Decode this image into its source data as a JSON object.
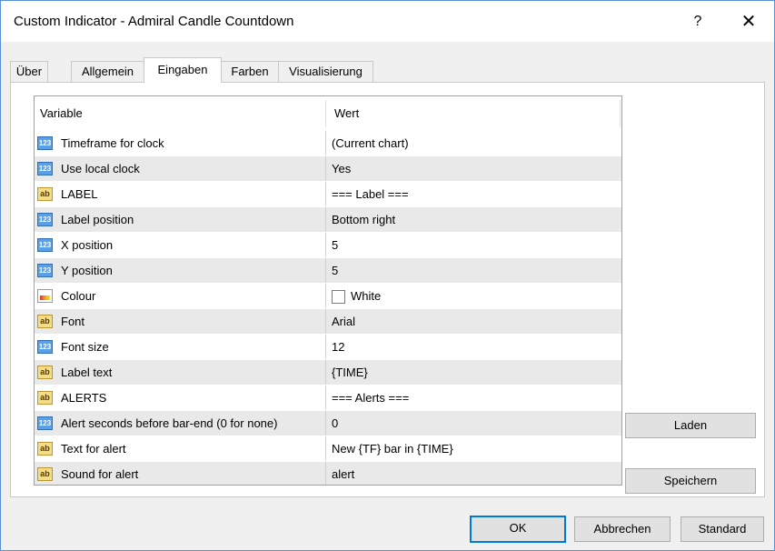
{
  "window": {
    "title": "Custom Indicator - Admiral Candle Countdown",
    "help_label": "?",
    "close_label": "✕"
  },
  "tabs": [
    {
      "label": "Über"
    },
    {
      "label": "Allgemein"
    },
    {
      "label": "Eingaben"
    },
    {
      "label": "Farben"
    },
    {
      "label": "Visualisierung"
    }
  ],
  "grid": {
    "headers": {
      "variable": "Variable",
      "value": "Wert"
    },
    "rows": [
      {
        "icon": "number-icon",
        "variable": "Timeframe for clock",
        "value": "(Current chart)"
      },
      {
        "icon": "number-icon",
        "variable": "Use local clock",
        "value": "Yes"
      },
      {
        "icon": "text-icon",
        "variable": "LABEL",
        "value": "=== Label ==="
      },
      {
        "icon": "number-icon",
        "variable": "Label position",
        "value": "Bottom right"
      },
      {
        "icon": "number-icon",
        "variable": "X position",
        "value": "5"
      },
      {
        "icon": "number-icon",
        "variable": "Y position",
        "value": "5"
      },
      {
        "icon": "color-icon",
        "variable": "Colour",
        "value": "White",
        "swatch_color": "#ffffff"
      },
      {
        "icon": "text-icon",
        "variable": "Font",
        "value": "Arial"
      },
      {
        "icon": "number-icon",
        "variable": "Font size",
        "value": "12"
      },
      {
        "icon": "text-icon",
        "variable": "Label text",
        "value": "{TIME}"
      },
      {
        "icon": "text-icon",
        "variable": "ALERTS",
        "value": "=== Alerts ==="
      },
      {
        "icon": "number-icon",
        "variable": "Alert seconds before bar-end (0 for none)",
        "value": "0"
      },
      {
        "icon": "text-icon",
        "variable": "Text for alert",
        "value": "New {TF} bar in {TIME}"
      },
      {
        "icon": "text-icon",
        "variable": "Sound for alert",
        "value": "alert"
      }
    ]
  },
  "side_buttons": {
    "load": "Laden",
    "save": "Speichern"
  },
  "footer_buttons": {
    "ok": "OK",
    "cancel": "Abbrechen",
    "default": "Standard"
  },
  "icon_glyphs": {
    "number-icon": "123",
    "text-icon": "ab",
    "color-icon": ""
  },
  "colors": {
    "accent": "#0078d7",
    "alt_row": "#e9e9e9",
    "number_icon": "#5aa0e6",
    "text_icon": "#f3dd8a"
  }
}
